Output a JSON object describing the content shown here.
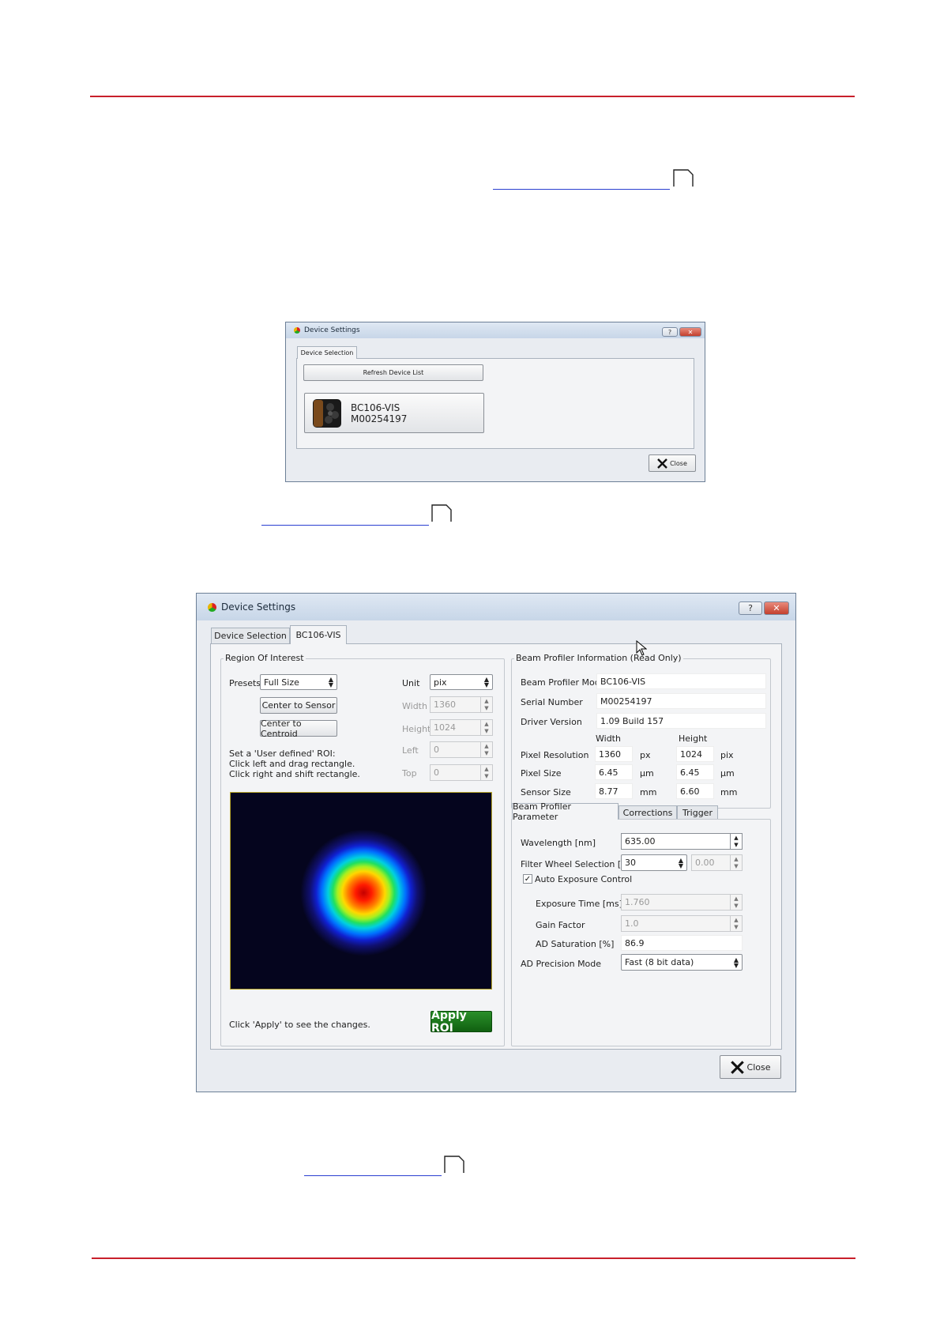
{
  "dialog1": {
    "title": "Device Settings",
    "help_glyph": "?",
    "close_glyph": "✕",
    "tab_device_selection": "Device Selection",
    "refresh_button": "Refresh Device List",
    "device_model": "BC106-VIS",
    "device_serial": "M00254197",
    "close_button": "Close"
  },
  "dialog2": {
    "title": "Device Settings",
    "help_glyph": "?",
    "close_glyph": "✕",
    "tabs": [
      "Device Selection",
      "BC106-VIS"
    ],
    "roi": {
      "group_title": "Region Of Interest",
      "presets_label": "Presets",
      "presets_value": "Full Size",
      "unit_label": "Unit",
      "unit_value": "pix",
      "center_sensor": "Center to Sensor",
      "center_centroid": "Center to Centroid",
      "width_label": "Width",
      "width_value": "1360",
      "height_label": "Height",
      "height_value": "1024",
      "left_label": "Left",
      "left_value": "0",
      "top_label": "Top",
      "top_value": "0",
      "hint_line1": "Set a 'User defined' ROI:",
      "hint_line2": "Click left and drag rectangle.",
      "hint_line3": "Click right  and shift rectangle.",
      "apply_hint": "Click 'Apply' to see the changes.",
      "apply_button": "Apply ROI"
    },
    "info": {
      "group_title": "Beam Profiler Information (Read Only)",
      "model_label": "Beam Profiler Model",
      "model_value": "BC106-VIS",
      "serial_label": "Serial Number",
      "serial_value": "M00254197",
      "driver_label": "Driver Version",
      "driver_value": "1.09 Build 157",
      "col_width": "Width",
      "col_height": "Height",
      "rows": [
        {
          "label": "Pixel Resolution",
          "w": "1360",
          "w_unit": "px",
          "h": "1024",
          "h_unit": "pix"
        },
        {
          "label": "Pixel Size",
          "w": "6.45",
          "w_unit": "µm",
          "h": "6.45",
          "h_unit": "µm"
        },
        {
          "label": "Sensor Size",
          "w": "8.77",
          "w_unit": "mm",
          "h": "6.60",
          "h_unit": "mm"
        }
      ]
    },
    "param_tabs": [
      "Beam Profiler Parameter",
      "Corrections",
      "Trigger"
    ],
    "params": {
      "wavelength_label": "Wavelength [nm]",
      "wavelength_value": "635.00",
      "filter_label": "Filter Wheel Selection [dB]",
      "filter_value": "30",
      "filter_extra": "0.00",
      "auto_exposure_label": "Auto Exposure Control",
      "auto_exposure_checked": true,
      "exposure_label": "Exposure Time [ms]",
      "exposure_value": "1.760",
      "gain_label": "Gain Factor",
      "gain_value": "1.0",
      "saturation_label": "AD Saturation [%]",
      "saturation_value": "86.9",
      "precision_label": "AD Precision Mode",
      "precision_value": "Fast (8 bit data)"
    },
    "close_button": "Close"
  },
  "colors": {
    "rule": "#c8202b",
    "link": "#2a3fd0",
    "apply_button": "#1e7a1e",
    "beam_background": "#05051e"
  }
}
